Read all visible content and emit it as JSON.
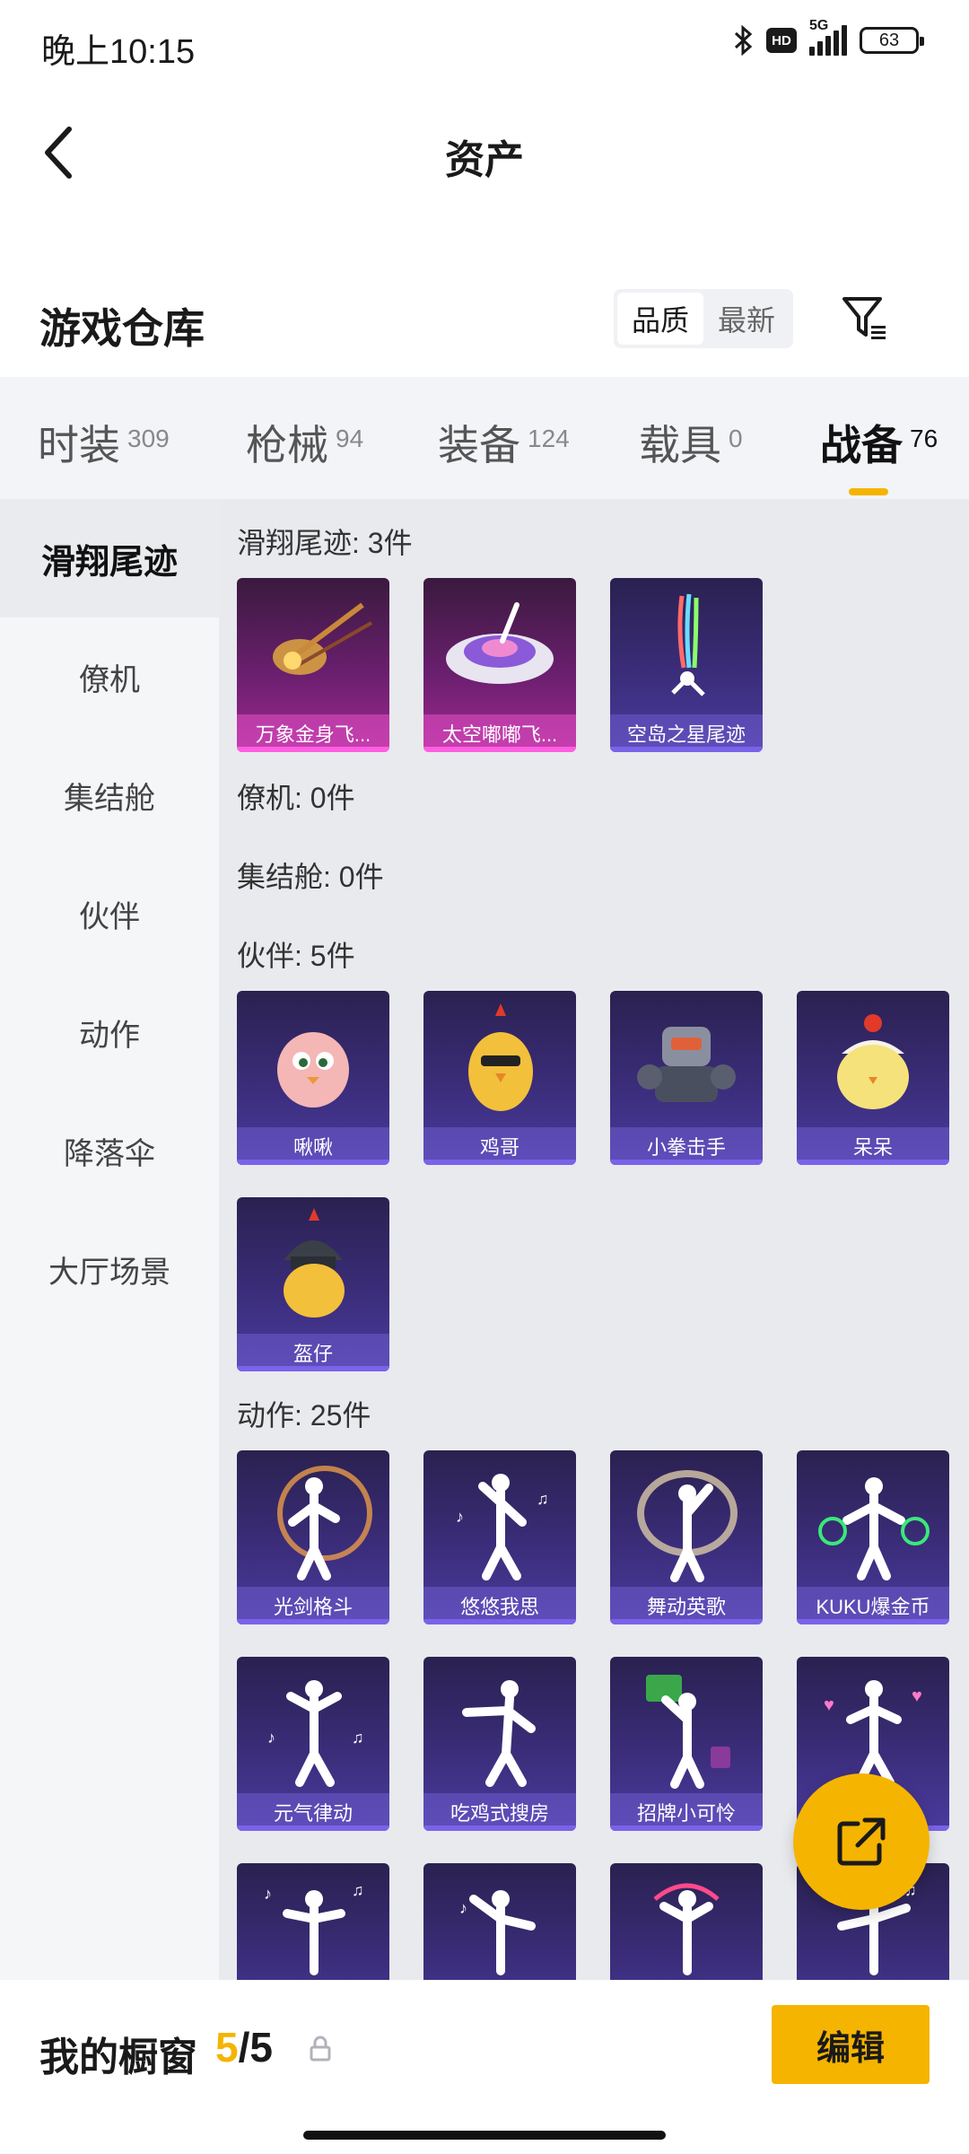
{
  "status": {
    "time": "晚上10:15",
    "hd": "HD",
    "net": "5G",
    "battery": "63"
  },
  "header": {
    "title": "资产"
  },
  "warehouse": {
    "title": "游戏仓库",
    "sort": [
      "品质",
      "最新"
    ]
  },
  "tabs": [
    {
      "label": "时装",
      "count": "309"
    },
    {
      "label": "枪械",
      "count": "94"
    },
    {
      "label": "装备",
      "count": "124"
    },
    {
      "label": "载具",
      "count": "0"
    },
    {
      "label": "战备",
      "count": "76"
    }
  ],
  "sidebar": [
    "滑翔尾迹",
    "僚机",
    "集结舱",
    "伙伴",
    "动作",
    "降落伞",
    "大厅场景"
  ],
  "sections": {
    "glide": {
      "title": "滑翔尾迹: 3件",
      "items": [
        "万象金身飞...",
        "太空嘟嘟飞...",
        "空岛之星尾迹"
      ]
    },
    "wingman": {
      "title": "僚机: 0件"
    },
    "pod": {
      "title": "集结舱: 0件"
    },
    "partner": {
      "title": "伙伴: 5件",
      "items": [
        "啾啾",
        "鸡哥",
        "小拳击手",
        "呆呆",
        "盔仔"
      ]
    },
    "action": {
      "title": "动作: 25件",
      "items": [
        "光剑格斗",
        "悠悠我思",
        "舞动英歌",
        "KUKU爆金币",
        "元气律动",
        "吃鸡式搜房",
        "招牌小可怜"
      ]
    }
  },
  "showcase": {
    "label": "我的橱窗",
    "current": "5",
    "total": "/5",
    "edit": "编辑"
  },
  "colors": {
    "accent": "#f5b400",
    "card_epic": "#3b2d7a",
    "card_legendary": "#a0288f"
  }
}
